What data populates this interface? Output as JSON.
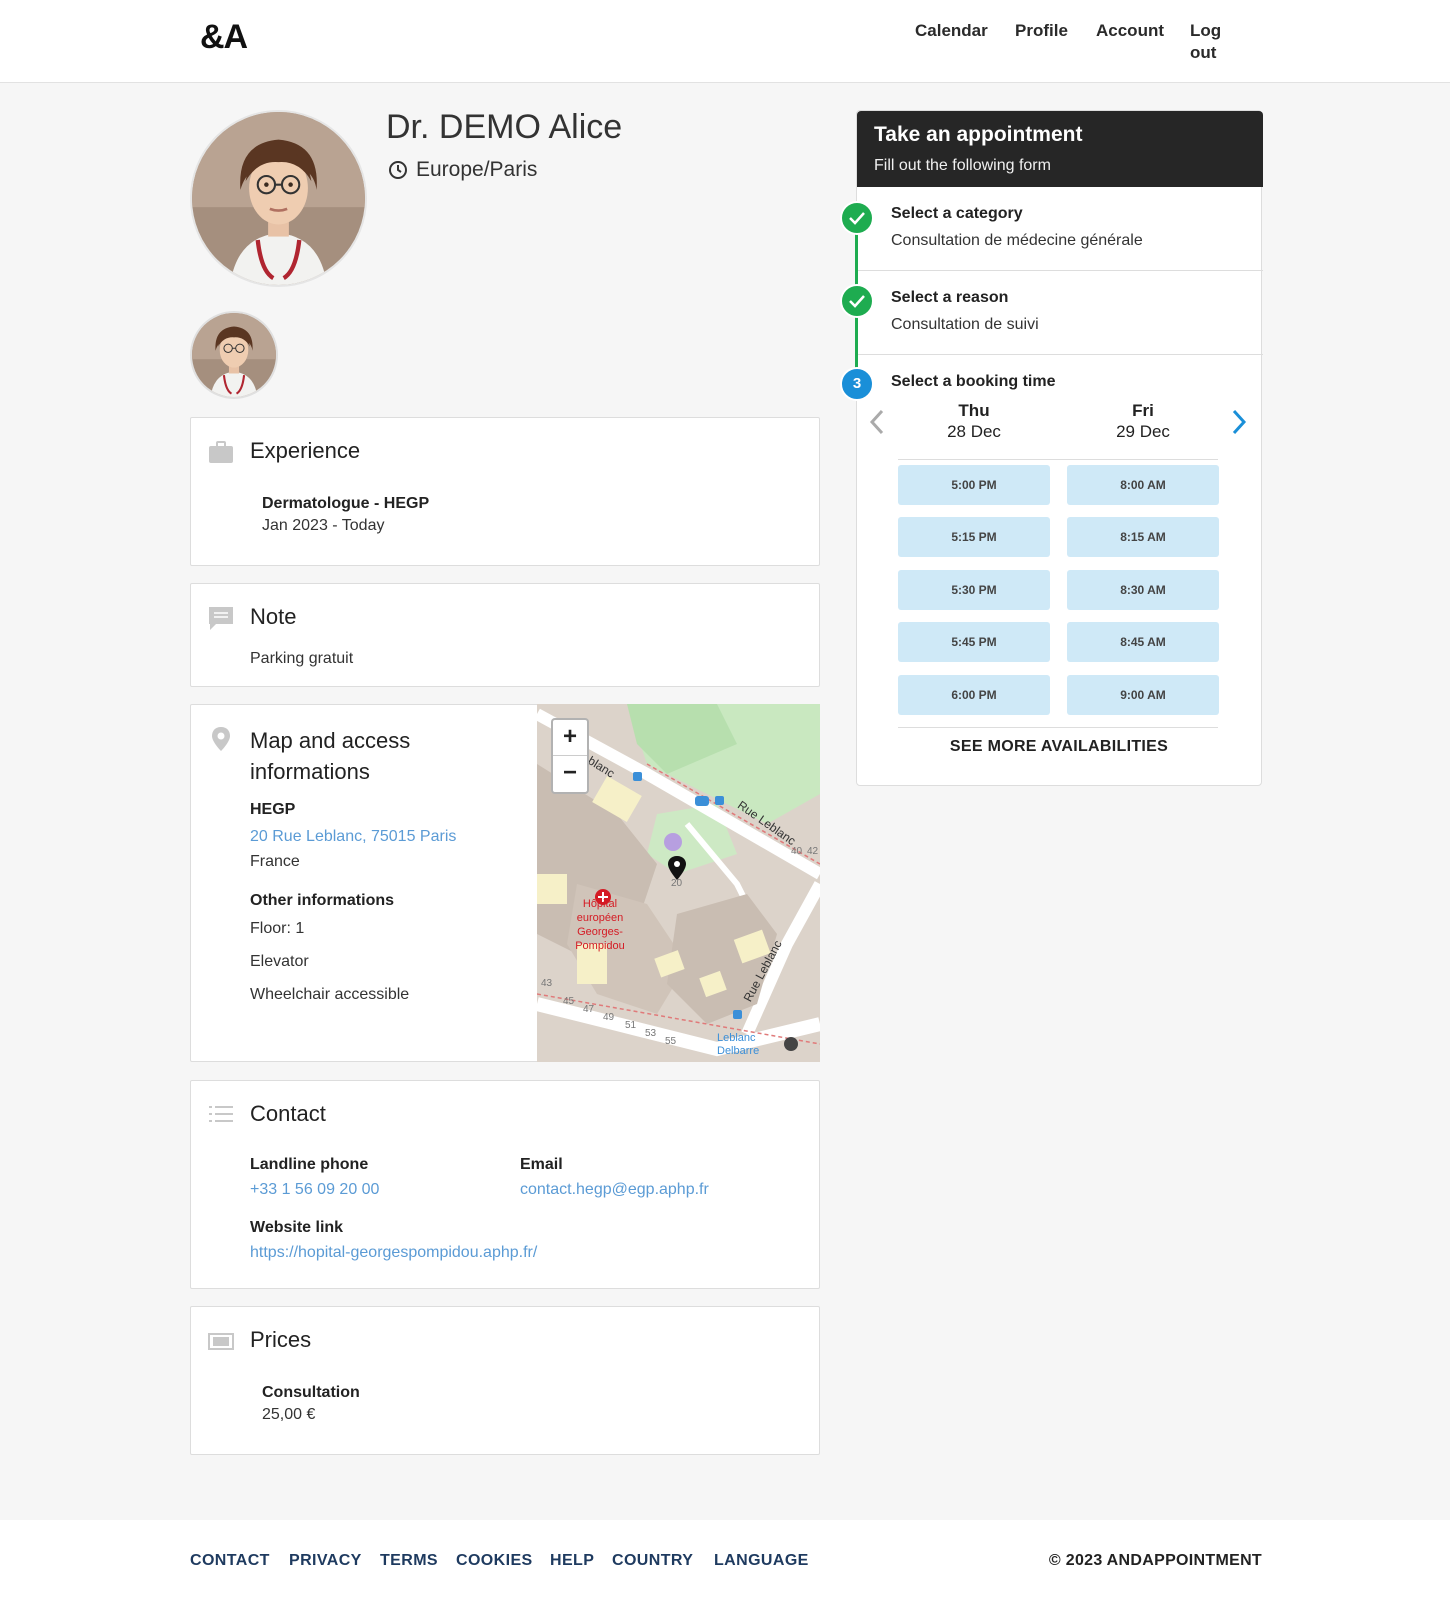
{
  "header": {
    "logo": "&A",
    "nav": [
      "Calendar",
      "Profile",
      "Account",
      "Log",
      "out"
    ]
  },
  "profile": {
    "name": "Dr. DEMO Alice",
    "timezone": "Europe/Paris"
  },
  "experience": {
    "title": "Experience",
    "role": "Dermatologue - HEGP",
    "period": "Jan 2023 - Today"
  },
  "note": {
    "title": "Note",
    "text": "Parking gratuit"
  },
  "map_section": {
    "title_line1": "Map and access",
    "title_line2": "informations",
    "place": "HEGP",
    "address": "20 Rue Leblanc, 75015 Paris",
    "country": "France",
    "other_title": "Other informations",
    "other": [
      "Floor: 1",
      "Elevator",
      "Wheelchair accessible"
    ],
    "map_labels": {
      "hospital": [
        "Hôpital",
        "européen",
        "Georges-",
        "Pompidou"
      ],
      "street1": "Rue Leblanc",
      "street2": "Rue Leblanc",
      "street3": "blanc",
      "stop": [
        "Leblanc",
        "Delbarre"
      ],
      "numbers": [
        "43",
        "45",
        "47",
        "49",
        "51",
        "53",
        "55",
        "40",
        "42",
        "20"
      ]
    },
    "zoom_in": "+",
    "zoom_out": "−"
  },
  "contact": {
    "title": "Contact",
    "phone_label": "Landline phone",
    "phone": "+33 1 56 09 20 00",
    "email_label": "Email",
    "email": "contact.hegp@egp.aphp.fr",
    "website_label": "Website link",
    "website": "https://hopital-georgespompidou.aphp.fr/"
  },
  "prices": {
    "title": "Prices",
    "item": "Consultation",
    "amount": "25,00 €"
  },
  "booking": {
    "title": "Take an appointment",
    "subtitle": "Fill out the following form",
    "steps": [
      {
        "title": "Select a category",
        "value": "Consultation de médecine générale"
      },
      {
        "title": "Select a reason",
        "value": "Consultation de suivi"
      },
      {
        "title": "Select a booking time",
        "number": "3"
      }
    ],
    "days": [
      {
        "dow": "Thu",
        "date": "28 Dec",
        "slots": [
          "5:00 PM",
          "5:15 PM",
          "5:30 PM",
          "5:45 PM",
          "6:00 PM"
        ]
      },
      {
        "dow": "Fri",
        "date": "29 Dec",
        "slots": [
          "8:00 AM",
          "8:15 AM",
          "8:30 AM",
          "8:45 AM",
          "9:00 AM"
        ]
      }
    ],
    "more": "SEE MORE AVAILABILITIES",
    "colors": {
      "done": "#1eac50",
      "current": "#1a8fd8",
      "slot": "#cfe9f7"
    }
  },
  "footer": {
    "links": [
      "CONTACT",
      "PRIVACY",
      "TERMS",
      "COOKIES",
      "HELP",
      "COUNTRY",
      "LANGUAGE"
    ],
    "copyright": "© 2023 ANDAPPOINTMENT"
  }
}
